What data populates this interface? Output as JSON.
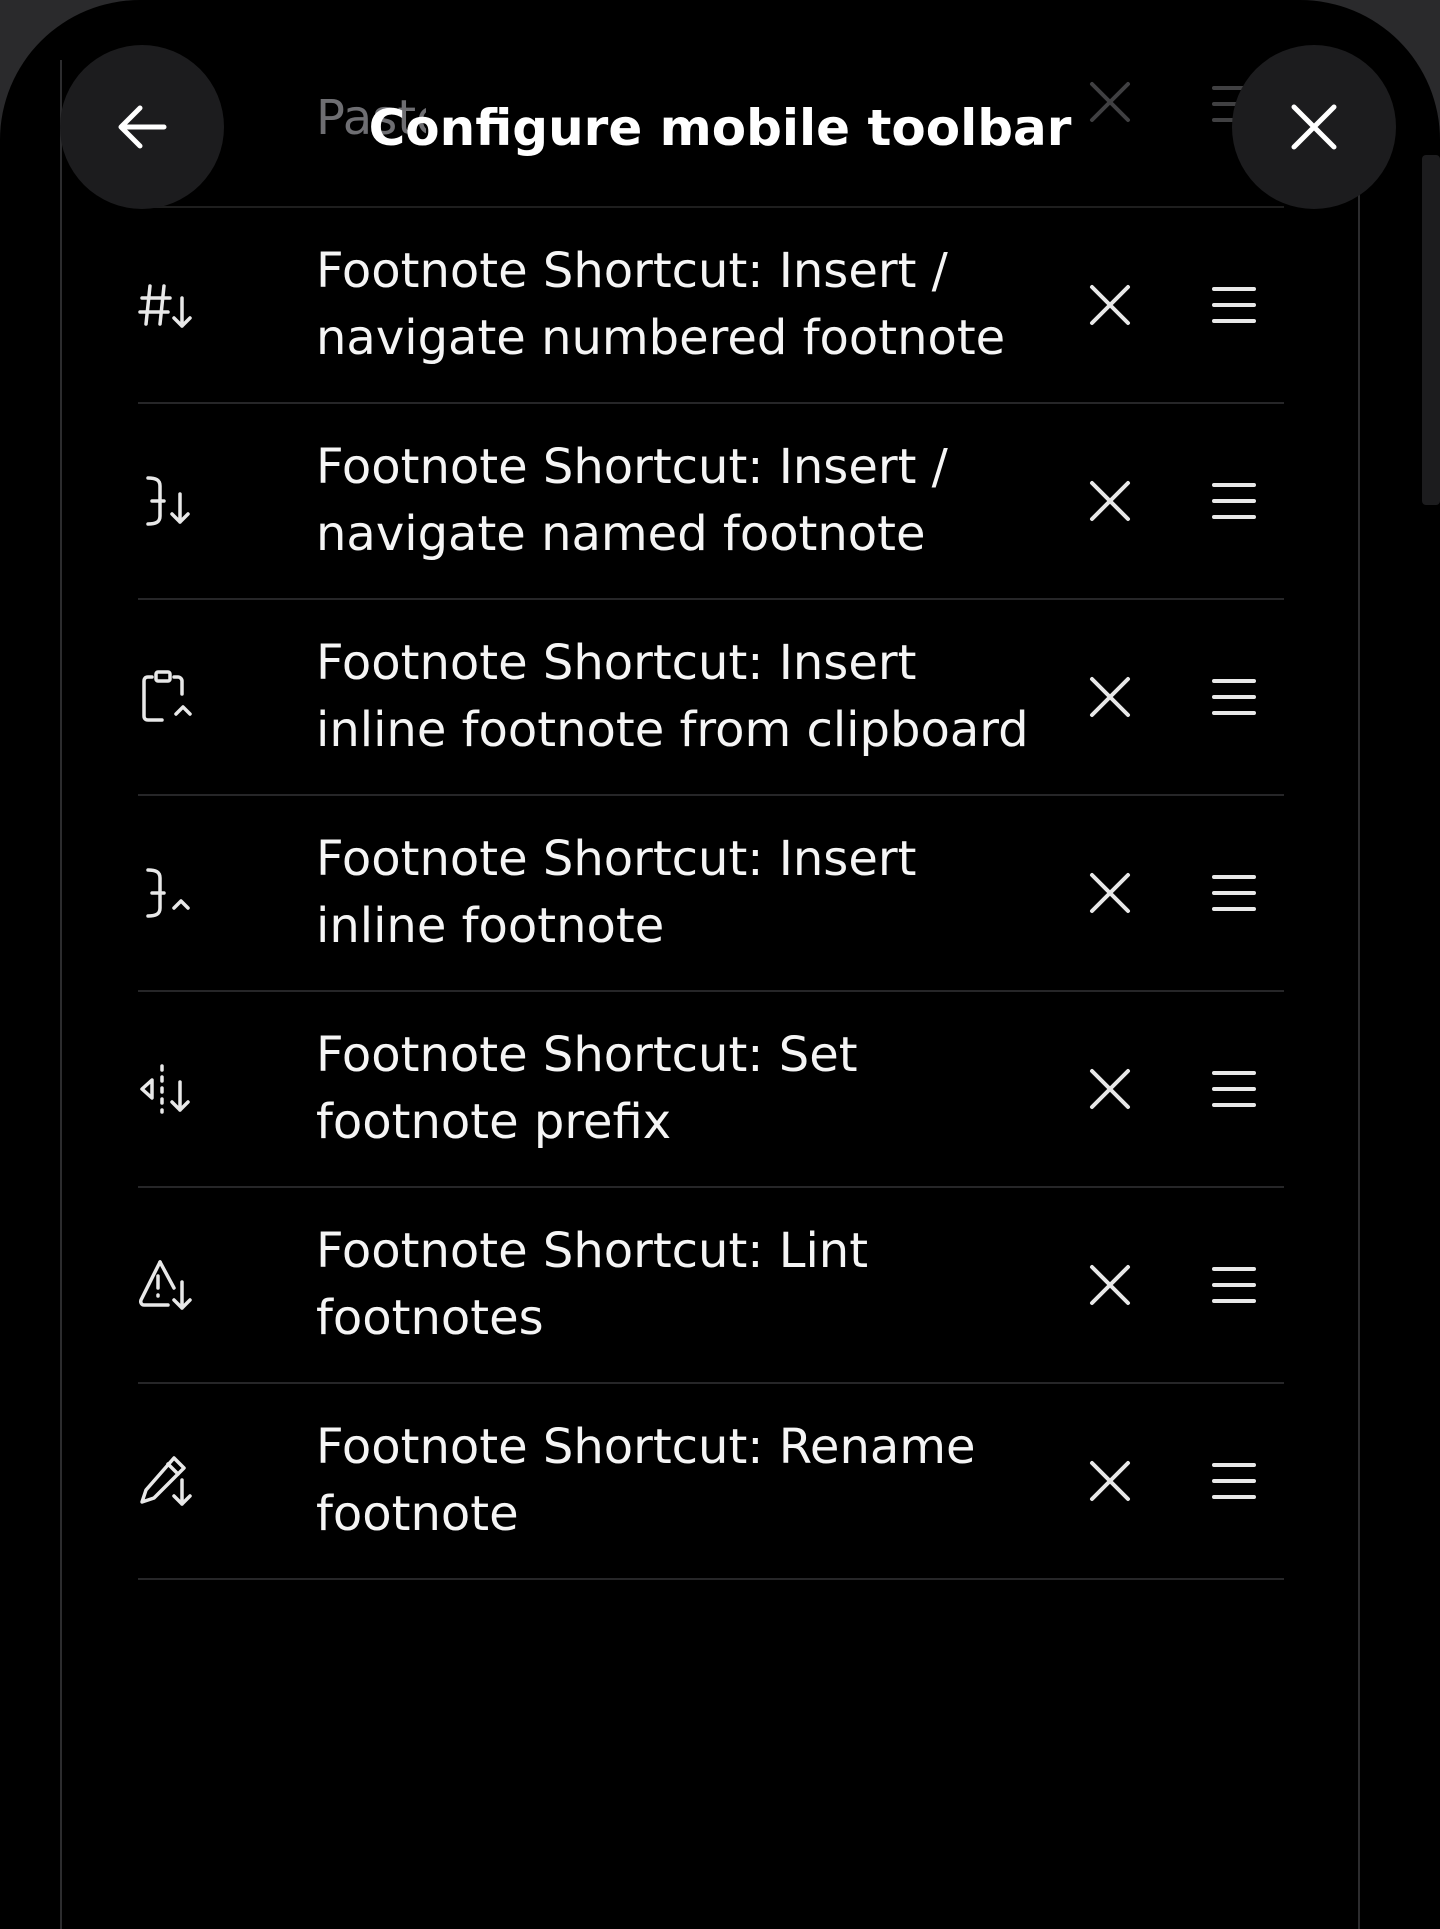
{
  "header": {
    "title": "Configure mobile toolbar",
    "back_icon": "arrow-left-icon",
    "close_icon": "close-icon",
    "ghost_row_text": "Paste"
  },
  "items": [
    {
      "label": "Footnote Shortcut: Insert / navigate numbered footnote",
      "icon": "hash-arrow-down-icon"
    },
    {
      "label": "Footnote Shortcut: Insert / navigate named footnote",
      "icon": "text-cursor-arrow-down-icon"
    },
    {
      "label": "Footnote Shortcut: Insert inline footnote from clipboard",
      "icon": "clipboard-arrow-up-icon"
    },
    {
      "label": "Footnote Shortcut: Insert inline footnote",
      "icon": "text-cursor-arrow-up-icon"
    },
    {
      "label": "Footnote Shortcut: Set footnote prefix",
      "icon": "split-arrow-down-icon"
    },
    {
      "label": "Footnote Shortcut: Lint footnotes",
      "icon": "warning-arrow-down-icon"
    },
    {
      "label": "Footnote Shortcut: Rename footnote",
      "icon": "pen-arrow-down-icon"
    }
  ],
  "colors": {
    "background": "#000000",
    "button_circle": "#1c1c1e",
    "divider": "#262628",
    "text": "#f5f5f5"
  }
}
